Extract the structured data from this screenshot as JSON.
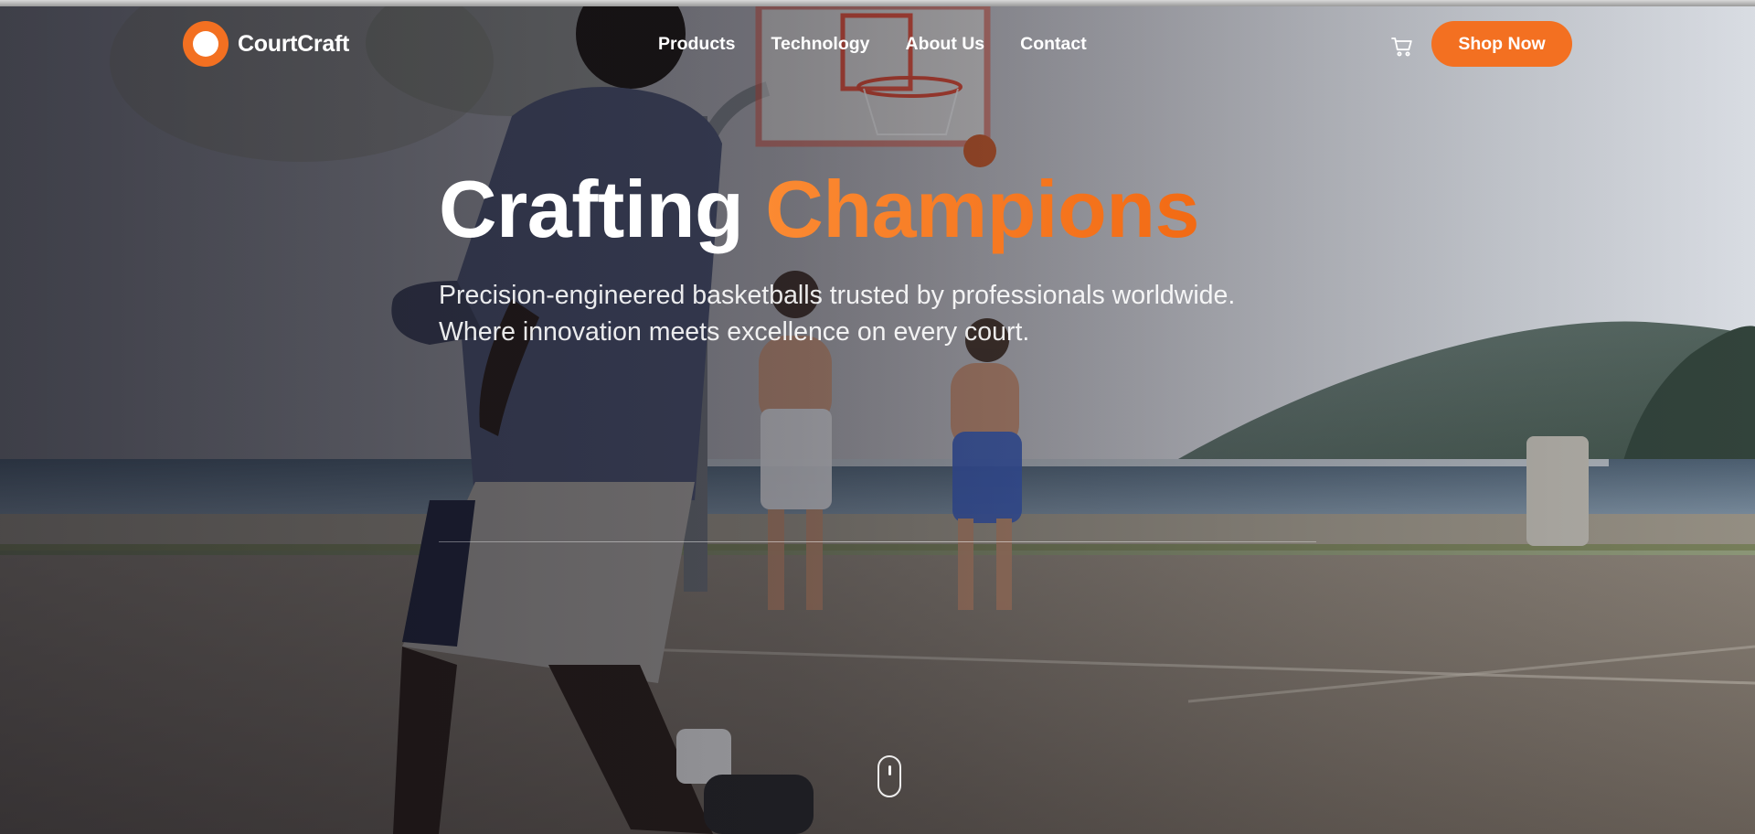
{
  "brand": {
    "name": "CourtCraft",
    "accent_color": "#f37021"
  },
  "nav": {
    "links": [
      {
        "label": "Products"
      },
      {
        "label": "Technology"
      },
      {
        "label": "About Us"
      },
      {
        "label": "Contact"
      }
    ],
    "cart_icon": "shopping-cart-icon",
    "cta_label": "Shop Now"
  },
  "hero": {
    "title_main": "Crafting",
    "title_accent": "Champions",
    "subtitle_line1": "Precision-engineered basketballs trusted by professionals worldwide.",
    "subtitle_line2": "Where innovation meets excellence on every court.",
    "background_image": "outdoor-basketball-court-by-the-sea",
    "scroll_icon": "mouse-scroll-icon"
  }
}
